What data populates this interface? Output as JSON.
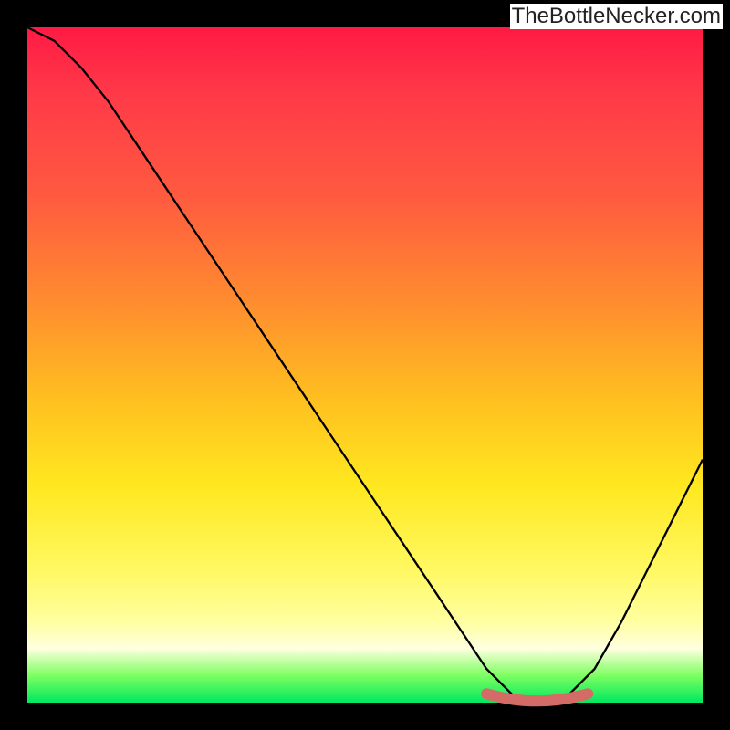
{
  "watermark": "TheBottleNecker.com",
  "colors": {
    "frame": "#000000",
    "watermark_text": "#222222",
    "watermark_bg": "#ffffff",
    "curve": "#000000",
    "highlight": "#d46b66"
  },
  "chart_data": {
    "type": "line",
    "title": "",
    "xlabel": "",
    "ylabel": "",
    "xlim": [
      0,
      100
    ],
    "ylim": [
      0,
      100
    ],
    "grid": false,
    "legend": false,
    "series": [
      {
        "name": "bottleneck-curve",
        "x": [
          0,
          4,
          8,
          12,
          16,
          20,
          24,
          28,
          32,
          36,
          40,
          44,
          48,
          52,
          56,
          60,
          64,
          68,
          72,
          76,
          80,
          84,
          88,
          92,
          96,
          100
        ],
        "y": [
          100,
          98,
          94,
          89,
          83,
          77,
          71,
          65,
          59,
          53,
          47,
          41,
          35,
          29,
          23,
          17,
          11,
          5,
          1,
          0,
          1,
          5,
          12,
          20,
          28,
          36
        ]
      }
    ],
    "annotations": [
      {
        "name": "optimal-range",
        "x_range": [
          68,
          83
        ],
        "y": 0.5
      }
    ]
  }
}
